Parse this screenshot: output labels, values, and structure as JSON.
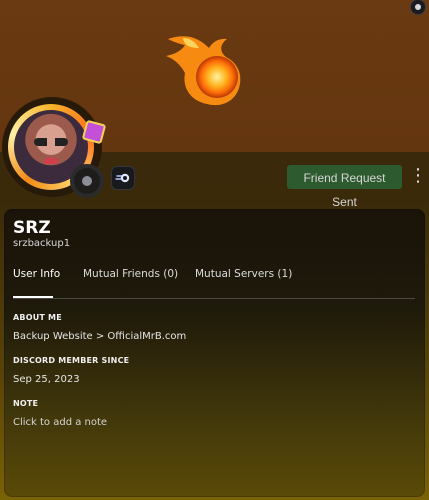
{
  "profile": {
    "display_name": "SRZ",
    "username": "srzbackup1",
    "friend_request_label": "Friend Request Sent",
    "more_label": "⋮"
  },
  "tabs": [
    {
      "label": "User Info"
    },
    {
      "label": "Mutual Friends (0)"
    },
    {
      "label": "Mutual Servers (1)"
    }
  ],
  "sections": {
    "about_title": "ABOUT ME",
    "about_value": "Backup Website > OfficialMrB.com",
    "member_title": "DISCORD MEMBER SINCE",
    "member_value": "Sep 25, 2023",
    "note_title": "NOTE",
    "note_placeholder": "Click to add a note"
  },
  "colors": {
    "banner": "#64360f",
    "button_green": "#2d5b2f",
    "text_primary": "#ffffff"
  },
  "icons": {
    "status": "offline-status-icon",
    "nitro": "nitro-badge-icon",
    "top": "top-right-status-icon"
  }
}
